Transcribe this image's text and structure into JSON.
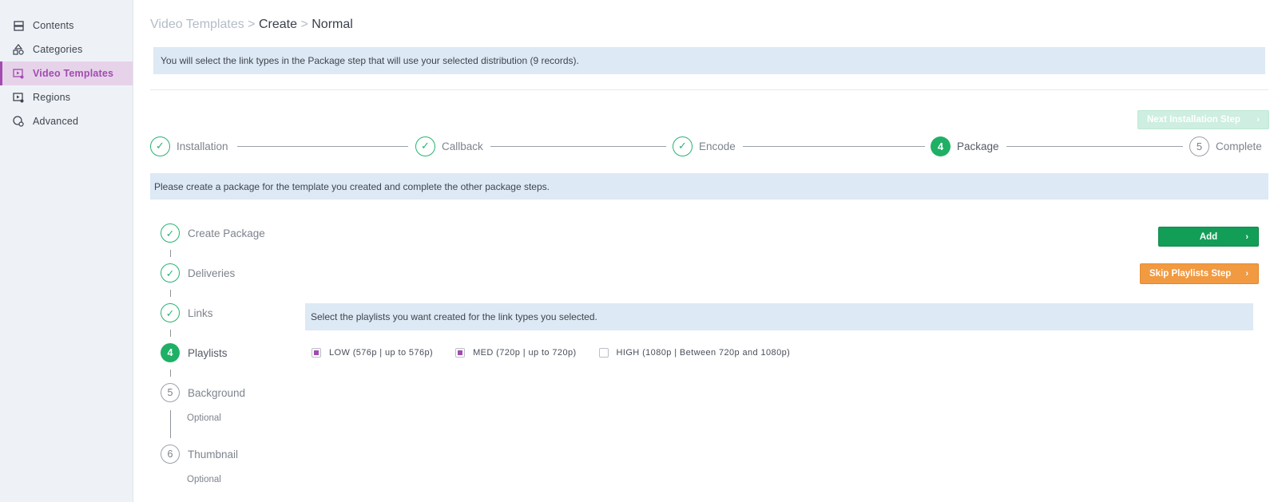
{
  "sidebar": {
    "items": [
      {
        "label": "Contents",
        "icon": "contents-icon"
      },
      {
        "label": "Categories",
        "icon": "categories-icon"
      },
      {
        "label": "Video Templates",
        "icon": "video-templates-icon"
      },
      {
        "label": "Regions",
        "icon": "regions-icon"
      },
      {
        "label": "Advanced",
        "icon": "advanced-icon"
      }
    ],
    "active_index": 2
  },
  "breadcrumb": {
    "part1": "Video Templates",
    "sep1": ">",
    "part2": "Create",
    "sep2": ">",
    "part3": "Normal"
  },
  "top_info": "You will select the link types in the Package step that will use your selected distribution (9 records).",
  "next_step_button": "Next Installation Step",
  "stepper": [
    {
      "label": "Installation",
      "state": "done"
    },
    {
      "label": "Callback",
      "state": "done"
    },
    {
      "label": "Encode",
      "state": "done"
    },
    {
      "label": "Package",
      "state": "current",
      "number": "4"
    },
    {
      "label": "Complete",
      "state": "todo",
      "number": "5"
    }
  ],
  "package_info": "Please create a package for the template you created and complete the other package steps.",
  "substeps": [
    {
      "label": "Create Package",
      "state": "done"
    },
    {
      "label": "Deliveries",
      "state": "done"
    },
    {
      "label": "Links",
      "state": "done"
    },
    {
      "label": "Playlists",
      "state": "current",
      "number": "4"
    },
    {
      "label": "Background",
      "state": "todo",
      "number": "5",
      "note": "Optional"
    },
    {
      "label": "Thumbnail",
      "state": "todo",
      "number": "6",
      "note": "Optional"
    }
  ],
  "add_button": "Add",
  "skip_button": "Skip Playlists Step",
  "playlists_info": "Select the playlists you want created for the link types you selected.",
  "playlists": [
    {
      "label": "LOW (576p | up to 576p)",
      "checked": true
    },
    {
      "label": "MED (720p | up to 720p)",
      "checked": true
    },
    {
      "label": "HIGH (1080p | Between 720p and 1080p)",
      "checked": false
    }
  ],
  "colors": {
    "accent_purple": "#a24bb0",
    "success_green": "#1fb066",
    "skip_orange": "#f19a41",
    "info_blue": "#dde9f4"
  }
}
